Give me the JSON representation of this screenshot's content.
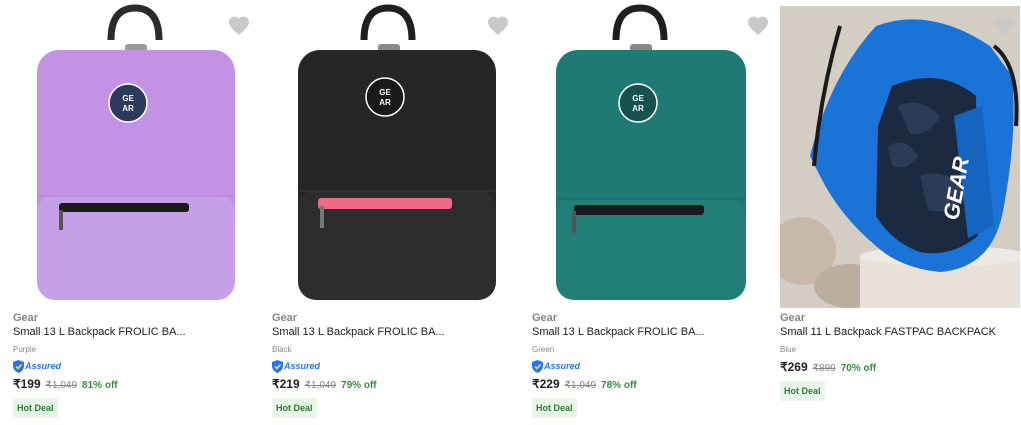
{
  "products": [
    {
      "brand": "Gear",
      "title": "Small 13 L Backpack FROLIC BA...",
      "color": "Purple",
      "assured": "Assured",
      "price": "₹199",
      "mrp": "₹1,049",
      "discount": "81% off",
      "deal": "Hot Deal",
      "image_color": "#c392e4",
      "logo_text": "GE AR",
      "zip_color": "#1a1a1a"
    },
    {
      "brand": "Gear",
      "title": "Small 13 L Backpack FROLIC BA...",
      "color": "Black",
      "assured": "Assured",
      "price": "₹219",
      "mrp": "₹1,049",
      "discount": "79% off",
      "deal": "Hot Deal",
      "image_color": "#262626",
      "logo_text": "GE AR",
      "zip_color": "#f06a86"
    },
    {
      "brand": "Gear",
      "title": "Small 13 L Backpack FROLIC BA...",
      "color": "Green",
      "assured": "Assured",
      "price": "₹229",
      "mrp": "₹1,049",
      "discount": "78% off",
      "deal": "Hot Deal",
      "image_color": "#1e7a73",
      "logo_text": "GE AR",
      "zip_color": "#1a1a1a"
    },
    {
      "brand": "Gear",
      "title": "Small 11 L Backpack FASTPAC BACKPACK",
      "color": "Blue",
      "assured": "",
      "price": "₹269",
      "mrp": "₹899",
      "discount": "70% off",
      "deal": "Hot Deal",
      "image_color": "#1a73d6",
      "logo_text": "GEAR",
      "zip_color": "#1a1a1a"
    }
  ]
}
